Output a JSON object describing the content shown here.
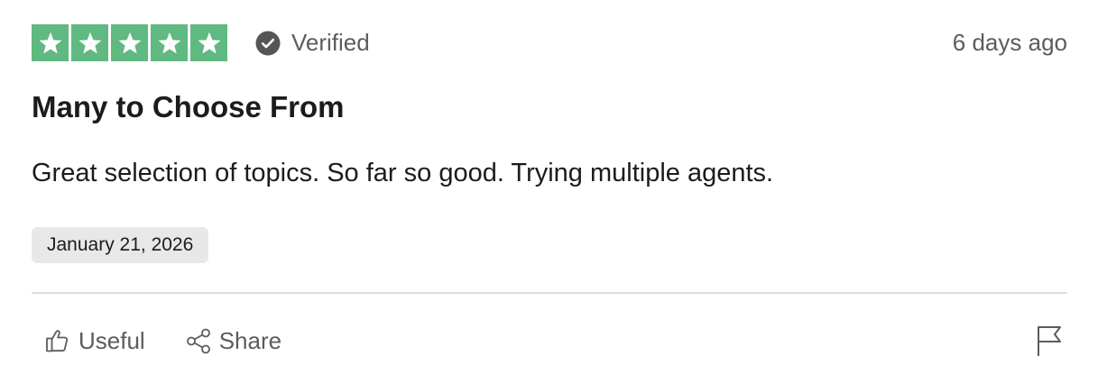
{
  "review": {
    "rating": 5,
    "rating_max": 5,
    "verified_label": "Verified",
    "age": "6 days ago",
    "title": "Many to Choose From",
    "body": "Great selection of topics. So far so good. Trying multiple agents.",
    "date": "January 21, 2026"
  },
  "actions": {
    "useful_label": "Useful",
    "share_label": "Share"
  },
  "icons": {
    "star": "star-icon",
    "verified": "check-circle-icon",
    "useful": "thumbs-up-icon",
    "share": "share-icon",
    "report": "flag-icon"
  },
  "colors": {
    "star_green": "#5fb981",
    "verified_badge": "#555555",
    "text": "#1c1c1c",
    "muted": "#5c5c5c",
    "date_badge_bg": "#e8e8e8",
    "divider": "#dcdcdc"
  }
}
